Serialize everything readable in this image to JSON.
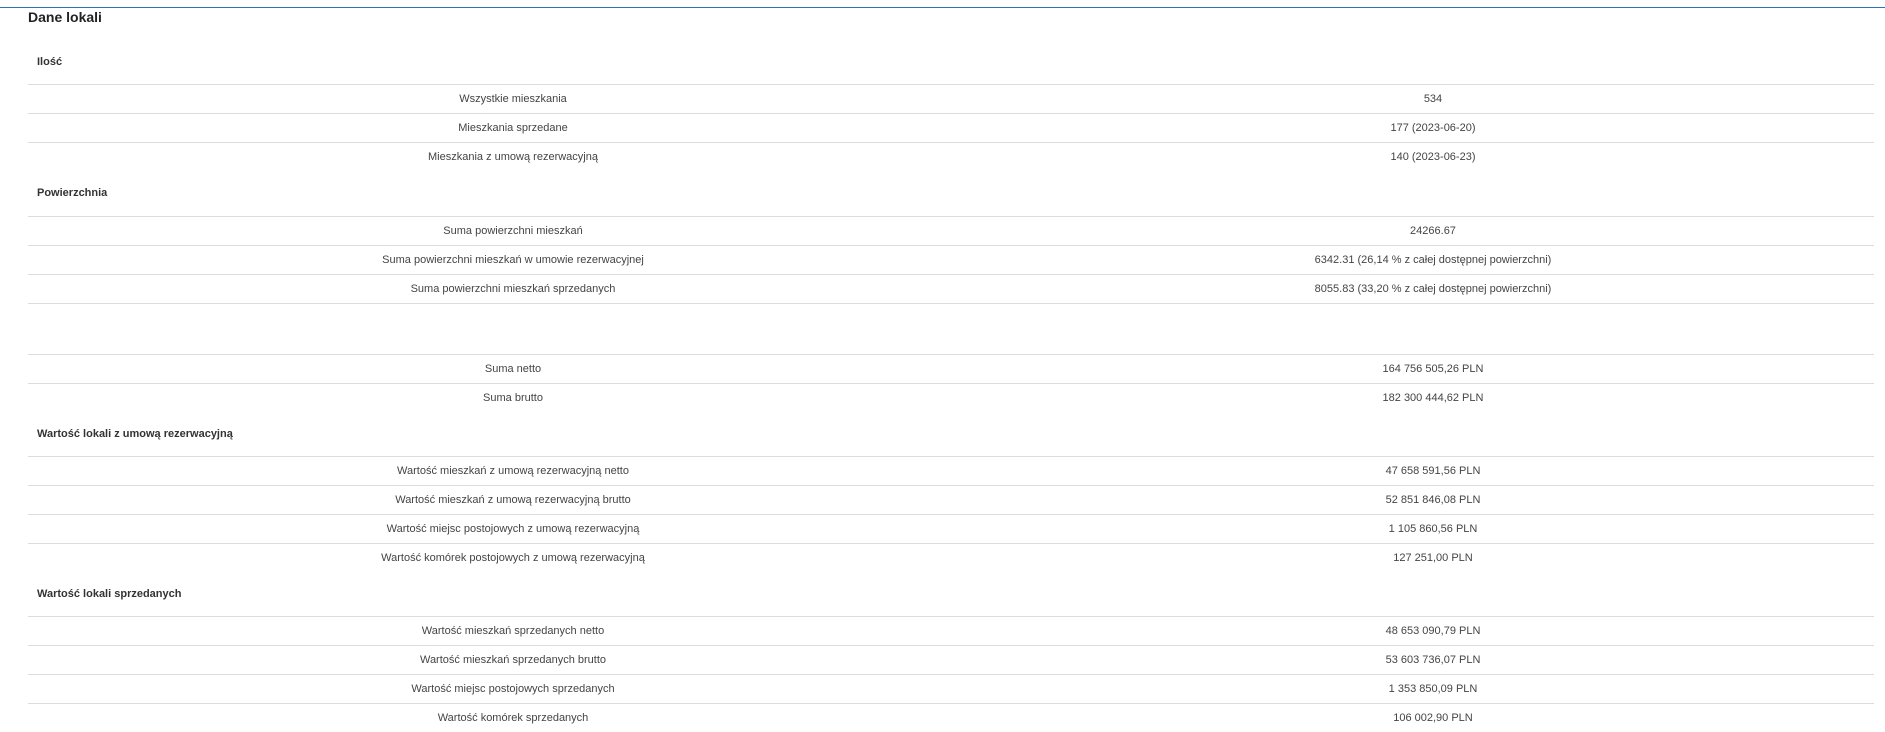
{
  "page": {
    "title": "Dane lokali"
  },
  "sections": [
    {
      "title": "Ilość",
      "rows": [
        {
          "label": "Wszystkie mieszkania",
          "value": "534"
        },
        {
          "label": "Mieszkania sprzedane",
          "value": "177 (2023-06-20)"
        },
        {
          "label": "Mieszkania z umową rezerwacyjną",
          "value": "140 (2023-06-23)"
        }
      ]
    },
    {
      "title": "Powierzchnia",
      "rows": [
        {
          "label": "Suma powierzchni mieszkań",
          "value": "24266.67"
        },
        {
          "label": "Suma powierzchni mieszkań w umowie rezerwacyjnej",
          "value": "6342.31 (26,14 % z całej dostępnej powierzchni)"
        },
        {
          "label": "Suma powierzchni mieszkań sprzedanych",
          "value": "8055.83 (33,20 % z całej dostępnej powierzchni)"
        }
      ]
    },
    {
      "title": "",
      "rows": [
        {
          "label": "Suma netto",
          "value": "164 756 505,26 PLN"
        },
        {
          "label": "Suma brutto",
          "value": "182 300 444,62 PLN"
        }
      ]
    },
    {
      "title": "Wartość lokali z umową rezerwacyjną",
      "rows": [
        {
          "label": "Wartość mieszkań z umową rezerwacyjną netto",
          "value": "47 658 591,56 PLN"
        },
        {
          "label": "Wartość mieszkań z umową rezerwacyjną brutto",
          "value": "52 851 846,08 PLN"
        },
        {
          "label": "Wartość miejsc postojowych z umową rezerwacyjną",
          "value": "1 105 860,56 PLN"
        },
        {
          "label": "Wartość komórek postojowych z umową rezerwacyjną",
          "value": "127 251,00 PLN"
        }
      ]
    },
    {
      "title": "Wartość lokali sprzedanych",
      "rows": [
        {
          "label": "Wartość mieszkań sprzedanych netto",
          "value": "48 653 090,79 PLN"
        },
        {
          "label": "Wartość mieszkań sprzedanych brutto",
          "value": "53 603 736,07 PLN"
        },
        {
          "label": "Wartość miejsc postojowych sprzedanych",
          "value": "1 353 850,09 PLN"
        },
        {
          "label": "Wartość komórek sprzedanych",
          "value": "106 002,90 PLN"
        }
      ]
    }
  ],
  "colors": {
    "accent": "#2b73b7",
    "divider": "#dcdcdc",
    "text": "#444444"
  }
}
